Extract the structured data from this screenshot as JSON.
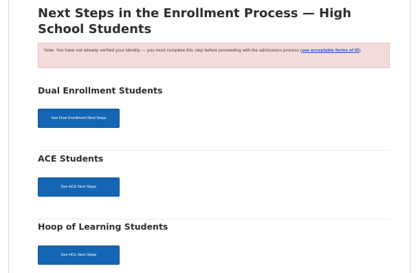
{
  "page": {
    "title": "Next Steps in the Enrollment Process — High School Students"
  },
  "alert": {
    "text_before": "Note: You have not already verified your identity — you must complete this step before proceeding with the admissions process (",
    "link_text": "see acceptable forms of ID",
    "text_after": ")."
  },
  "sections": [
    {
      "heading": "Dual Enrollment Students",
      "button_label": "See Dual Enrollment Next Steps"
    },
    {
      "heading": "ACE Students",
      "button_label": "See ACE Next Steps"
    },
    {
      "heading": "Hoop of Learning Students",
      "button_label": "See HOL Next Steps"
    }
  ],
  "colors": {
    "button": "#1366b3",
    "alert_background": "#f5dcdc",
    "link": "#1a56c4"
  }
}
